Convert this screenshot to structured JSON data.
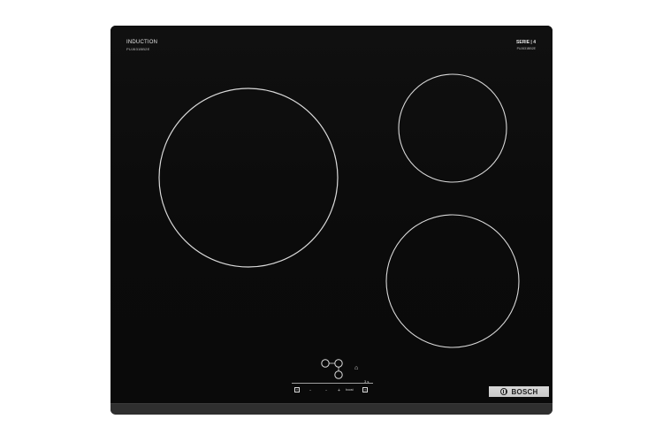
{
  "cooktop": {
    "left_label": "INDUCTION",
    "left_small_label": "PUJ631BB2E",
    "right_label": "SERIE | 4",
    "right_small_label": "PUJ631BB2E"
  },
  "controls": {
    "on_off_symbol": "⏻",
    "minus_label": "−",
    "dash_label": "−",
    "plus_label": "+",
    "boost_label": "boost",
    "timer_symbol": "◷",
    "top_small_label": "3 s",
    "lock_symbol": "⌂"
  },
  "brand": {
    "name": "BOSCH"
  },
  "colors": {
    "glass": "#0b0b0b",
    "zone_outline": "#d9d9d9",
    "brand_plate": "#d0d0d0",
    "base_strip": "#2f2f2f"
  }
}
